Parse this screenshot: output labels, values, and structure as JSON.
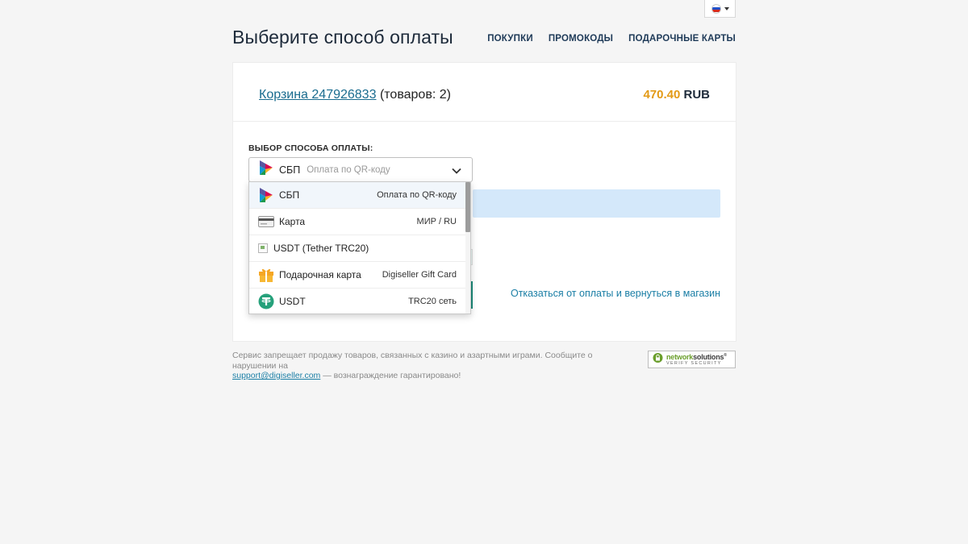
{
  "language": {
    "selected_flag": "russia-flag"
  },
  "header": {
    "title": "Выберите способ оплаты",
    "nav": [
      "ПОКУПКИ",
      "ПРОМОКОДЫ",
      "ПОДАРОЧНЫЕ КАРТЫ"
    ]
  },
  "cart": {
    "link_text": "Корзина 247926833",
    "items_text": "(товаров: 2)",
    "amount": "470.40",
    "currency": "RUB"
  },
  "payment": {
    "label": "ВЫБОР СПОСОБА ОПЛАТЫ:",
    "selected": {
      "name": "СБП",
      "desc": "Оплата по QR-коду",
      "icon": "sbp-icon"
    },
    "options": [
      {
        "name": "СБП",
        "desc": "Оплата по QR-коду",
        "icon": "sbp-icon"
      },
      {
        "name": "Карта",
        "desc": "МИР / RU",
        "icon": "card-icon"
      },
      {
        "name": "USDT (Tether TRC20)",
        "desc": "",
        "icon": "broken-image-icon"
      },
      {
        "name": "Подарочная карта",
        "desc": "Digiseller Gift Card",
        "icon": "gift-icon"
      },
      {
        "name": "USDT",
        "desc": "TRC20 сеть",
        "icon": "tether-icon"
      }
    ],
    "cancel_link": "Отказаться от оплаты и вернуться в магазин"
  },
  "footer": {
    "note": "Сервис запрещает продажу товаров, связанных с казино и азартными играми. Сообщите о нарушении на",
    "email": "support@digiseller.com",
    "note_tail": " — вознаграждение гарантировано!",
    "badge_brand_1": "network",
    "badge_brand_2": "solutions",
    "badge_sub": "VERIFY SECURITY"
  },
  "colors": {
    "accent_price": "#e39a16",
    "link": "#1a7ea5",
    "info_bar": "#d4e8fa"
  }
}
